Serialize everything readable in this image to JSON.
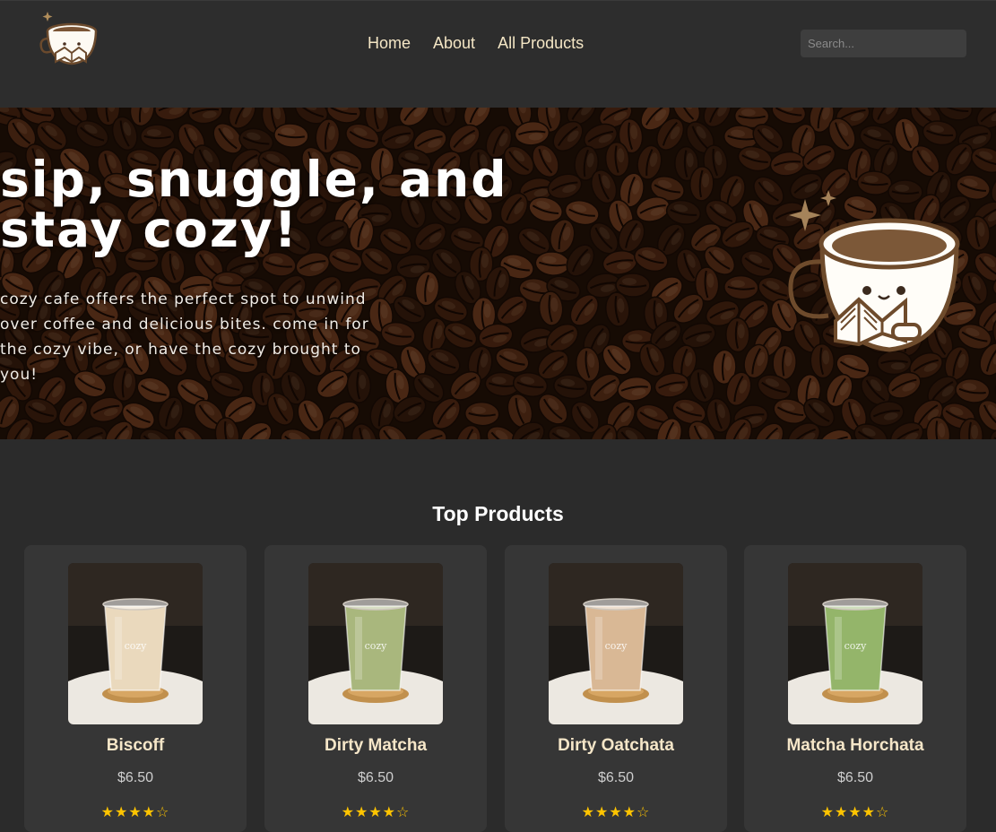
{
  "header": {
    "nav": [
      {
        "label": "Home"
      },
      {
        "label": "About"
      },
      {
        "label": "All Products"
      }
    ],
    "search_placeholder": "Search..."
  },
  "hero": {
    "headline_line1": "sip, snuggle, and",
    "headline_line2": "stay cozy!",
    "body_line1": "cozy cafe offers the perfect spot to unwind",
    "body_line2": "over coffee and delicious bites. come in for",
    "body_line3": "the cozy vibe, or have the cozy brought to",
    "body_line4": "you!"
  },
  "products": {
    "title": "Top Products",
    "items": [
      {
        "name": "Biscoff",
        "price": "$6.50",
        "rating": "★★★★☆",
        "cup_label": "cozy",
        "drink_color": "#ead9bd"
      },
      {
        "name": "Dirty Matcha",
        "price": "$6.50",
        "rating": "★★★★☆",
        "cup_label": "cozy",
        "drink_color": "#a9b77d"
      },
      {
        "name": "Dirty Oatchata",
        "price": "$6.50",
        "rating": "★★★★☆",
        "cup_label": "cozy",
        "drink_color": "#d9b895"
      },
      {
        "name": "Matcha Horchata",
        "price": "$6.50",
        "rating": "★★★★☆",
        "cup_label": "cozy",
        "drink_color": "#94b56a"
      }
    ]
  },
  "icons": {
    "logo": "coffee-cup-reading-book-logo",
    "mascot": "coffee-cup-reading-book-mascot"
  },
  "colors": {
    "background": "#2b2b2b",
    "card": "#363636",
    "nav_text": "#f4e6c5",
    "product_name": "#f5e6c8",
    "stars": "#ffc400"
  }
}
